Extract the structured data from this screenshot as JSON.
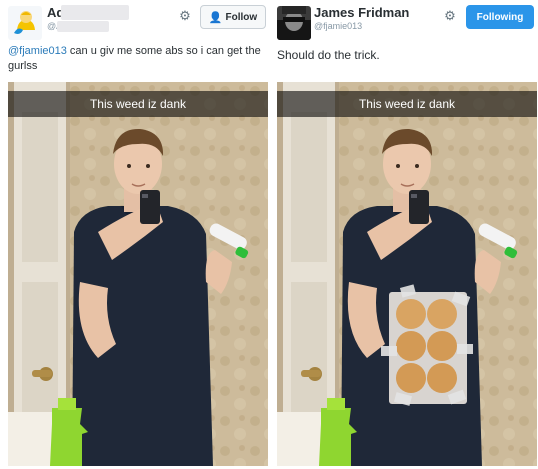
{
  "left_tweet": {
    "author_name": "Ad",
    "author_handle": "@A",
    "follow_label": "Follow",
    "mention": "@fjamie013",
    "text": " can u giv me some abs so i can get the gurlss",
    "photo_caption": "This weed iz dank"
  },
  "right_tweet": {
    "author_name": "James Fridman",
    "author_handle": "@fjamie013",
    "following_label": "Following",
    "text": "Should do the trick.",
    "photo_caption": "This weed iz dank"
  },
  "colors": {
    "link": "#2b7bb9",
    "following_button": "#2b95e9",
    "handle": "#8899a6"
  }
}
